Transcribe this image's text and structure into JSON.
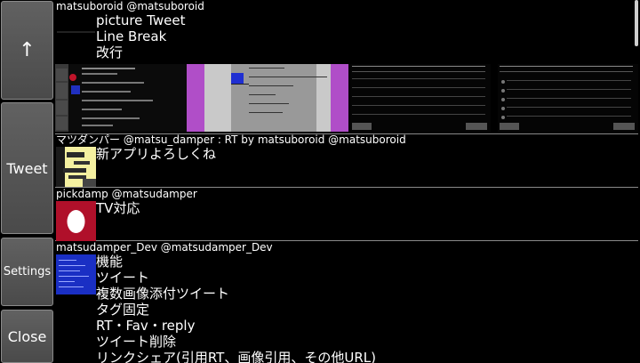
{
  "sidebar": {
    "up_label": "↑",
    "tweet_label": "Tweet",
    "settings_label": "Settings",
    "close_label": "Close"
  },
  "tweets": [
    {
      "header": "matsuboroid @matsuboroid",
      "lines": [
        "picture Tweet",
        "Line Break",
        "改行"
      ]
    },
    {
      "header": "マツダンパー @matsu_damper : RT by matsuboroid @matsuboroid",
      "lines": [
        "新アプリよろしくね"
      ]
    },
    {
      "header": "pickdamp @matsudamper",
      "lines": [
        "TV対応"
      ]
    },
    {
      "header": "matsudamper_Dev @matsudamper_Dev",
      "lines": [
        "機能",
        "ツイート",
        "複数画像添付ツイート",
        "タグ固定",
        "RT・Fav・reply",
        "ツイート削除",
        "リンクシェア(引用RT、画像引用、その他URL)"
      ]
    }
  ],
  "colors": {
    "background": "#000000",
    "button_fill": "#555555",
    "divider": "#8a8a8a",
    "avatar_red": "#b0102a",
    "avatar_blue": "#1a2fc4"
  }
}
